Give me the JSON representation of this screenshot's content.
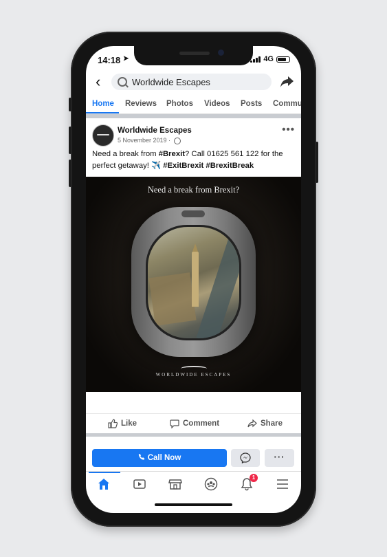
{
  "status": {
    "time": "14:18",
    "network": "4G",
    "battery_level": 0.75
  },
  "topbar": {
    "search_text": "Worldwide Escapes"
  },
  "tabs": [
    {
      "label": "Home",
      "active": true
    },
    {
      "label": "Reviews"
    },
    {
      "label": "Photos"
    },
    {
      "label": "Videos"
    },
    {
      "label": "Posts"
    },
    {
      "label": "Commu"
    }
  ],
  "post": {
    "author": "Worldwide Escapes",
    "date": "5 November 2019 ·",
    "text_1": "Need a break from ",
    "hashtag_brexit": "#Brexit",
    "text_2": "? Call 01625 561 122 for the perfect getaway! ✈️ ",
    "hashtag_exitbrexit": "#ExitBrexit",
    "hashtag_brexitbreak": "#BrexitBreak",
    "image_headline": "Need a break from Brexit?",
    "image_logo_text": "WORLDWIDE ESCAPES"
  },
  "actions": {
    "like": "Like",
    "comment": "Comment",
    "share": "Share"
  },
  "cta": {
    "call_now": "Call Now",
    "more": "···"
  },
  "bottom_nav": {
    "notifications_badge": "1"
  },
  "colors": {
    "accent": "#1877f2",
    "badge": "#f02849"
  }
}
